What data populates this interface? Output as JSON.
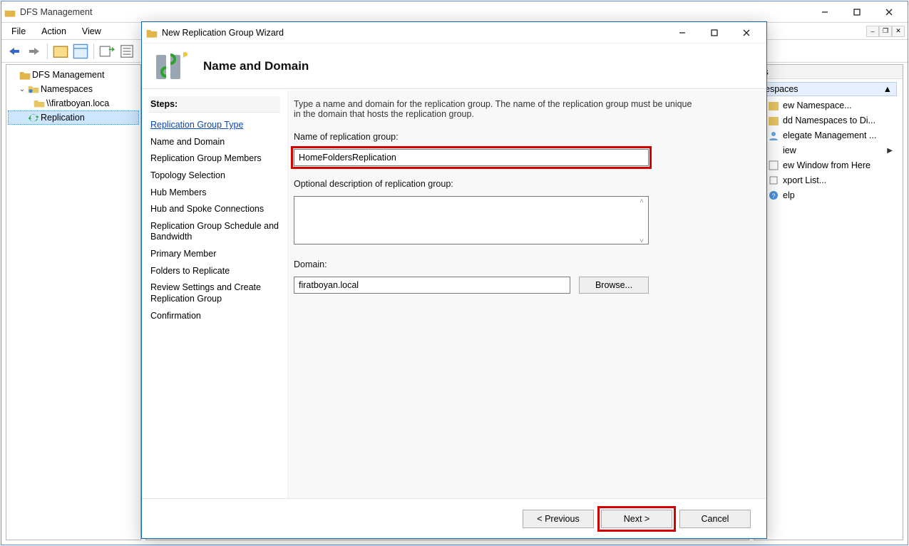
{
  "main_window": {
    "title": "DFS Management",
    "menu": {
      "file": "File",
      "action": "Action",
      "view": "View"
    }
  },
  "tree": {
    "root": "DFS Management",
    "namespaces": "Namespaces",
    "ns_item": "\\\\firatboyan.loca",
    "replication": "Replication"
  },
  "actions": {
    "header": "ns",
    "section": "espaces",
    "items": {
      "new_namespace": "ew Namespace...",
      "add_namespaces": "dd Namespaces to Di...",
      "delegate": "elegate Management ...",
      "view": "iew",
      "new_window": "ew Window from Here",
      "export": "xport List...",
      "help": "elp"
    }
  },
  "wizard": {
    "title": "New Replication Group Wizard",
    "heading": "Name and Domain",
    "steps_title": "Steps:",
    "steps": {
      "type": "Replication Group Type",
      "name": "Name and Domain",
      "members": "Replication Group Members",
      "topology": "Topology Selection",
      "hub": "Hub Members",
      "spoke": "Hub and Spoke Connections",
      "schedule": "Replication Group Schedule and Bandwidth",
      "primary": "Primary Member",
      "folders": "Folders to Replicate",
      "review": "Review Settings and Create Replication Group",
      "confirm": "Confirmation"
    },
    "intro": "Type a name and domain for the replication group. The name of the replication group must be unique in the domain that hosts the replication group.",
    "labels": {
      "name": "Name of replication group:",
      "desc": "Optional description of replication group:",
      "domain": "Domain:",
      "browse": "Browse..."
    },
    "values": {
      "name": "HomeFoldersReplication",
      "desc": "",
      "domain": "firatboyan.local"
    },
    "buttons": {
      "prev": "< Previous",
      "next": "Next >",
      "cancel": "Cancel"
    }
  }
}
